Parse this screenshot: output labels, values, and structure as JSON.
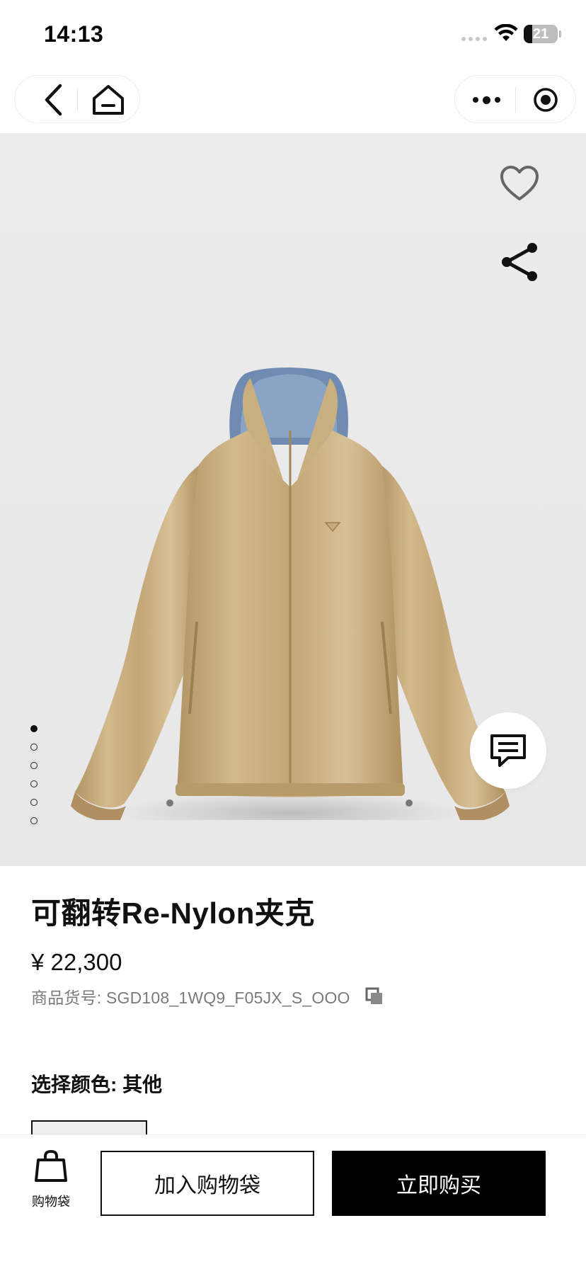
{
  "status_bar": {
    "time": "14:13",
    "battery_level": "21",
    "icons": [
      "signal-icon",
      "wifi-icon",
      "battery-icon"
    ]
  },
  "nav": {
    "left_icons": [
      "back-arrow-icon",
      "home-icon"
    ],
    "right_icons": [
      "more-dots-icon",
      "close-target-icon"
    ]
  },
  "gallery": {
    "image_count": 6,
    "active_index": 0,
    "icons": [
      "heart-icon",
      "share-icon",
      "chat-icon"
    ]
  },
  "product": {
    "title": "可翻转Re-Nylon夹克",
    "price": "¥ 22,300",
    "sku": "商品货号: SGD108_1WQ9_F05JX_S_OOO",
    "color_label": "选择颜色: 其他"
  },
  "bottom_bar": {
    "bag_label": "购物袋",
    "add_to_bag": "加入购物袋",
    "buy_now": "立即购买"
  },
  "colors": {
    "accent": "#000000",
    "background_hero": "#ebebeb",
    "muted_text": "#7a7a7a"
  }
}
